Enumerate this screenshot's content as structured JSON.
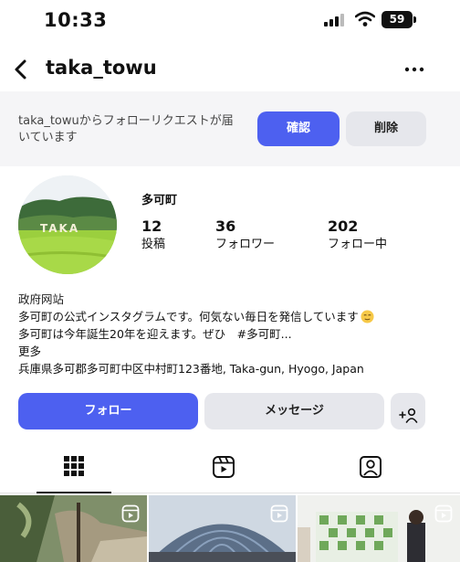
{
  "status_bar": {
    "time": "10:33",
    "battery": "59"
  },
  "nav": {
    "title": "taka_towu",
    "back_icon": "chevron-left-icon",
    "more_icon": "more-horizontal-icon"
  },
  "follow_request": {
    "text": "taka_towuからフォローリクエストが届いています",
    "confirm_label": "確認",
    "delete_label": "削除"
  },
  "profile": {
    "name": "多可町",
    "avatar_text": "TAKA",
    "stats": [
      {
        "value": "12",
        "label": "投稿"
      },
      {
        "value": "36",
        "label": "フォロワー"
      },
      {
        "value": "202",
        "label": "フォロー中"
      }
    ]
  },
  "bio": {
    "category": "政府网站",
    "line1": "多可町の公式インスタグラムです。何気ない毎日を発信しています",
    "line2": "多可町は今年誕生20年を迎えます。ぜひ　#多可町...",
    "more": "更多",
    "address": "兵庫県多可郡多可町中区中村町123番地, Taka-gun, Hyogo, Japan"
  },
  "actions": {
    "follow_label": "フォロー",
    "message_label": "メッセージ",
    "add_user_icon": "add-person-icon"
  },
  "tabs": [
    {
      "name": "grid",
      "icon": "grid-icon",
      "active": true
    },
    {
      "name": "reels",
      "icon": "reels-icon",
      "active": false
    },
    {
      "name": "tagged",
      "icon": "tagged-person-icon",
      "active": false
    }
  ],
  "colors": {
    "primary": "#4d60f0",
    "secondary_button": "#e6e7ec",
    "banner_bg": "#f5f5f7"
  }
}
